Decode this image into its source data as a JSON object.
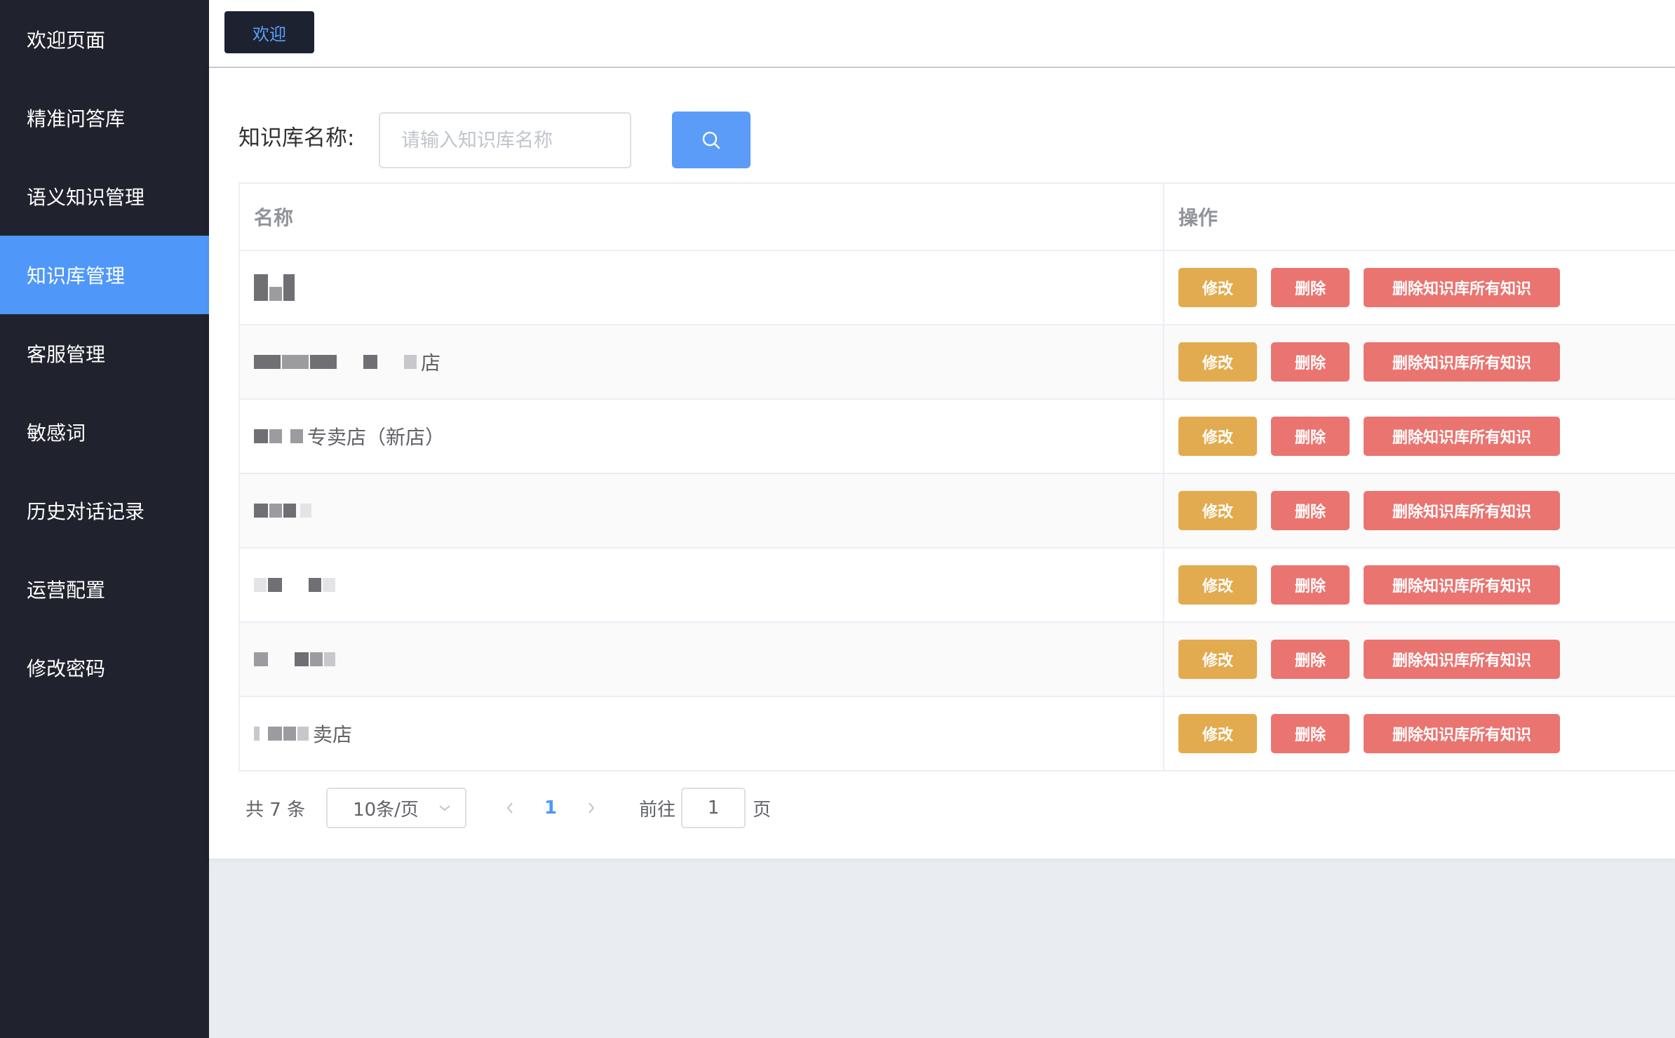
{
  "sidebar": {
    "items": [
      {
        "label": "欢迎页面"
      },
      {
        "label": "精准问答库"
      },
      {
        "label": "语义知识管理"
      },
      {
        "label": "知识库管理",
        "active": true
      },
      {
        "label": "客服管理"
      },
      {
        "label": "敏感词"
      },
      {
        "label": "历史对话记录"
      },
      {
        "label": "运营配置"
      },
      {
        "label": "修改密码"
      }
    ]
  },
  "topbar": {
    "tab_label": "欢迎"
  },
  "search": {
    "label": "知识库名称:",
    "placeholder": "请输入知识库名称"
  },
  "table": {
    "headers": {
      "name": "名称",
      "ops": "操作"
    },
    "rows": [
      {
        "name_visible": ""
      },
      {
        "name_visible": "店"
      },
      {
        "name_visible": "专卖店（新店）"
      },
      {
        "name_visible": ""
      },
      {
        "name_visible": ""
      },
      {
        "name_visible": ""
      },
      {
        "name_visible": "卖店"
      }
    ],
    "actions": {
      "edit": "修改",
      "delete": "删除",
      "delete_all": "删除知识库所有知识"
    }
  },
  "pagination": {
    "total_text": "共 7 条",
    "page_size": "10条/页",
    "current_page": "1",
    "goto_label": "前往",
    "goto_value": "1",
    "page_suffix": "页"
  },
  "colors": {
    "sidebar_bg": "#20232d",
    "active": "#4f97f9",
    "edit_button": "#e3ab4f",
    "delete_button": "#ea7470"
  }
}
